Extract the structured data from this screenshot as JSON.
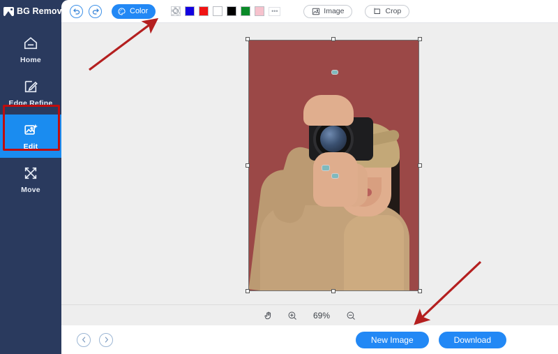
{
  "app": {
    "brand": "BG Remover",
    "brand_icon": "image-icon",
    "sidebar_bg": "#2a3a5e",
    "accent": "#2288f5",
    "active_bg": "#1a8cf0",
    "annotation_color": "#c00d0d"
  },
  "sidebar": {
    "items": [
      {
        "label": "Home",
        "icon": "home-icon",
        "active": false
      },
      {
        "label": "Edge Refine",
        "icon": "edge-refine-icon",
        "active": false
      },
      {
        "label": "Edit",
        "icon": "edit-image-icon",
        "active": true
      },
      {
        "label": "Move",
        "icon": "move-icon",
        "active": false
      }
    ]
  },
  "toolbar": {
    "undo_icon": "undo-icon",
    "redo_icon": "redo-icon",
    "color_label": "Color",
    "color_icon": "palette-icon",
    "swatches": [
      {
        "name": "transparent",
        "color": "transparent"
      },
      {
        "name": "blue",
        "color": "#1200e0"
      },
      {
        "name": "red",
        "color": "#f01414"
      },
      {
        "name": "white",
        "color": "#ffffff"
      },
      {
        "name": "black",
        "color": "#000000"
      },
      {
        "name": "green",
        "color": "#0a8a28"
      },
      {
        "name": "pink",
        "color": "#f6c2cd"
      }
    ],
    "more_label": "•••",
    "image_label": "Image",
    "image_icon": "image-icon",
    "crop_label": "Crop",
    "crop_icon": "crop-icon"
  },
  "canvas": {
    "background": "#eeeeee",
    "photo": {
      "background_color": "#9b4847",
      "alt": "person holding a camera in front of face wearing tan puffer jacket and knit beanie",
      "selected": true,
      "handles": 8
    }
  },
  "zoombar": {
    "hand_icon": "hand-icon",
    "zoom_in_icon": "zoom-in-icon",
    "zoom_value": "69%",
    "zoom_out_icon": "zoom-out-icon"
  },
  "bottombar": {
    "prev_icon": "chevron-left-icon",
    "next_icon": "chevron-right-icon",
    "new_image_label": "New Image",
    "download_label": "Download"
  },
  "annotations": [
    {
      "name": "arrow-to-transparent-swatch",
      "color": "#c00d0d"
    },
    {
      "name": "arrow-to-zoom-controls",
      "color": "#c00d0d"
    },
    {
      "name": "box-around-edit-tab",
      "color": "#c00d0d"
    }
  ]
}
